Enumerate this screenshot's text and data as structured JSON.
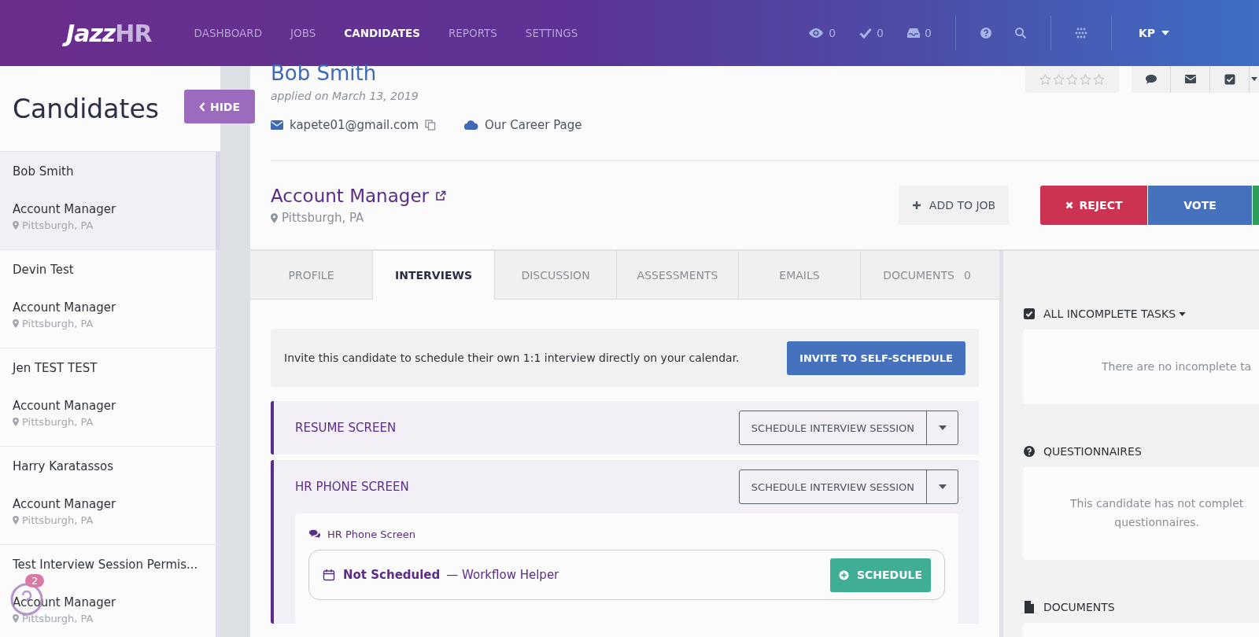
{
  "header": {
    "logo": {
      "main": "Jazz",
      "accent": "HR"
    },
    "nav": [
      {
        "label": "DASHBOARD",
        "selected": false
      },
      {
        "label": "JOBS",
        "selected": false
      },
      {
        "label": "CANDIDATES",
        "selected": true
      },
      {
        "label": "REPORTS",
        "selected": false
      },
      {
        "label": "SETTINGS",
        "selected": false
      }
    ],
    "counters": [
      {
        "kind": "views",
        "count": "0"
      },
      {
        "kind": "tasks",
        "count": "0"
      },
      {
        "kind": "inbox",
        "count": "0"
      }
    ],
    "user": "KP"
  },
  "sidebar": {
    "title": "Candidates",
    "hide_button": "HIDE",
    "candidates": [
      {
        "name": "Bob Smith",
        "job": "Account Manager",
        "location": "Pittsburgh, PA",
        "selected": true
      },
      {
        "name": "Devin Test",
        "job": "Account Manager",
        "location": "Pittsburgh, PA",
        "selected": false
      },
      {
        "name": "Jen TEST TEST",
        "job": "Account Manager",
        "location": "Pittsburgh, PA",
        "selected": false
      },
      {
        "name": "Harry Karatassos",
        "job": "Account Manager",
        "location": "Pittsburgh, PA",
        "selected": false
      },
      {
        "name": "Test Interview Session Permis...",
        "job": "Account Manager",
        "location": "Pittsburgh, PA",
        "selected": false
      }
    ]
  },
  "help_widget": {
    "badge": "2"
  },
  "candidate": {
    "name": "Bob Smith",
    "applied": "applied on March 13, 2019",
    "email": "kapete01@gmail.com",
    "source": "Our Career Page",
    "stars": 0,
    "tools": [
      {
        "kind": "comment"
      },
      {
        "kind": "email"
      },
      {
        "kind": "task"
      },
      {
        "kind": "more"
      }
    ],
    "job": {
      "title": "Account Manager",
      "location": "Pittsburgh, PA"
    },
    "add_button": "ADD TO JOB",
    "reject_button": "REJECT",
    "vote_button": "VOTE"
  },
  "tabs": [
    {
      "label": "PROFILE",
      "selected": false
    },
    {
      "label": "INTERVIEWS",
      "selected": true
    },
    {
      "label": "DISCUSSION",
      "selected": false
    },
    {
      "label": "ASSESSMENTS",
      "selected": false
    },
    {
      "label": "EMAILS",
      "selected": false
    },
    {
      "label": "DOCUMENTS",
      "count": "0",
      "selected": false
    }
  ],
  "interviews": {
    "invite_text": "Invite this candidate to schedule their own 1:1 interview directly on your calendar.",
    "invite_button": "INVITE TO SELF-SCHEDULE",
    "stages": [
      {
        "title": "RESUME SCREEN",
        "button": "SCHEDULE INTERVIEW SESSION"
      },
      {
        "title": "HR PHONE SCREEN",
        "button": "SCHEDULE INTERVIEW SESSION",
        "sessions": [
          {
            "title": "HR Phone Screen",
            "status": "Not Scheduled",
            "detail": "— Workflow Helper",
            "button": "SCHEDULE"
          }
        ]
      }
    ]
  },
  "side_panel": [
    {
      "kind": "tasks",
      "title": "ALL INCOMPLETE TASKS",
      "message": "There are no incomplete ta"
    },
    {
      "kind": "questionnaires",
      "title": "QUESTIONNAIRES",
      "message": "This candidate has not complet\nquestionnaires."
    },
    {
      "kind": "documents",
      "title": "DOCUMENTS"
    }
  ]
}
